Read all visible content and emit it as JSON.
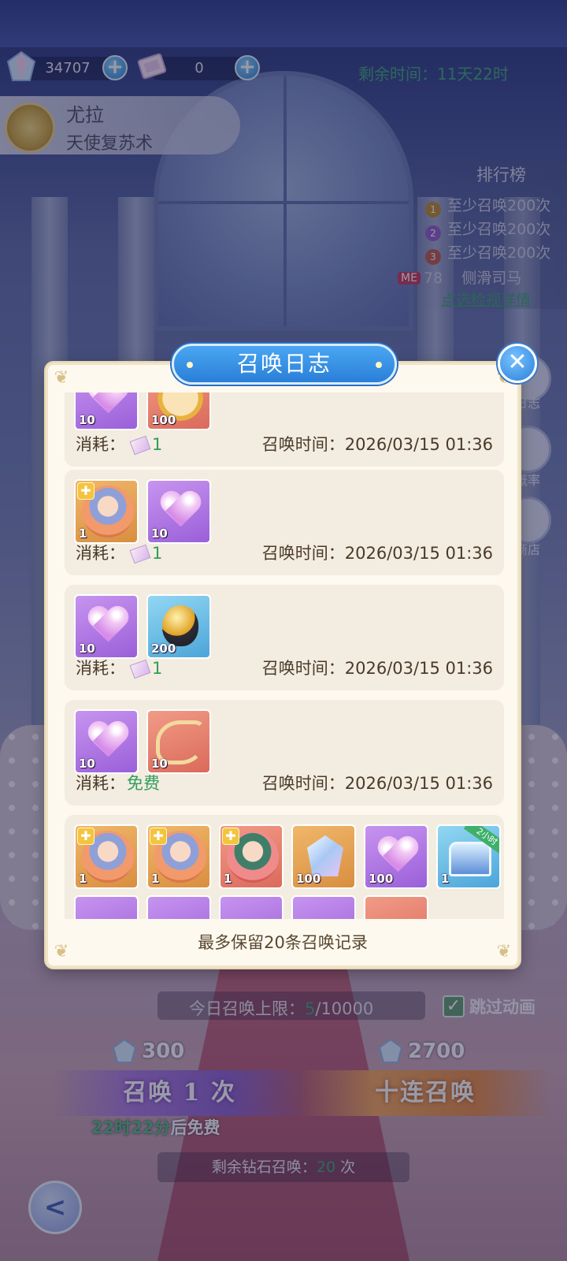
{
  "currency": {
    "diamond_amount": "34707",
    "ticket_amount": "0",
    "plus_symbol": "+",
    "remaining_label": "剩余时间：11天22时"
  },
  "character": {
    "name": "尤拉",
    "subtitle": "天使复苏术"
  },
  "ranking": {
    "title": "排行榜",
    "rows": [
      {
        "medal": "1",
        "text": "至少召唤200次",
        "color": "#b9892f"
      },
      {
        "medal": "2",
        "text": "至少召唤200次",
        "color": "#8e59c9"
      },
      {
        "medal": "3",
        "text": "至少召唤200次",
        "color": "#b8584a"
      }
    ],
    "me_badge": "ME",
    "me_rank": "78",
    "me_name": "侧滑司马",
    "detail_link": "点选检视详情"
  },
  "side_buttons": {
    "log_label": "日志",
    "rate_label": "概率",
    "shop_label": "商店"
  },
  "modal": {
    "title": "召唤日志",
    "close_symbol": "✕",
    "note": "最多保留20条召唤记录",
    "records": [
      {
        "cost_label": "消耗：",
        "cost_value": "1",
        "time_label": "召唤时间：",
        "time": "2026/03/15 01:36",
        "items": [
          {
            "type": "heart",
            "color": "purple",
            "qty": "10"
          },
          {
            "type": "coin",
            "color": "red",
            "qty": "100"
          }
        ]
      },
      {
        "cost_label": "消耗：",
        "cost_value": "1",
        "time_label": "召唤时间：",
        "time": "2026/03/15 01:36",
        "items": [
          {
            "type": "fragment",
            "color": "gold",
            "qty": "1",
            "puzzle": true
          },
          {
            "type": "heart",
            "color": "purple",
            "qty": "10"
          }
        ]
      },
      {
        "cost_label": "消耗：",
        "cost_value": "1",
        "time_label": "召唤时间：",
        "time": "2026/03/15 01:36",
        "items": [
          {
            "type": "heart",
            "color": "purple",
            "qty": "10"
          },
          {
            "type": "egg",
            "color": "blue",
            "qty": "200"
          }
        ]
      },
      {
        "cost_label": "消耗：",
        "cost_value": "免费",
        "time_label": "召唤时间：",
        "time": "2026/03/15 01:36",
        "items": [
          {
            "type": "heart",
            "color": "purple",
            "qty": "10"
          },
          {
            "type": "dragon",
            "color": "red",
            "qty": "10"
          }
        ]
      },
      {
        "items": [
          {
            "type": "fragment",
            "color": "gold",
            "qty": "1",
            "puzzle": true
          },
          {
            "type": "fragment",
            "color": "gold",
            "qty": "1",
            "puzzle": true
          },
          {
            "type": "fragment",
            "color": "red",
            "qty": "1",
            "puzzle": true
          },
          {
            "type": "crystal",
            "color": "gold",
            "qty": "100"
          },
          {
            "type": "heart",
            "color": "purple",
            "qty": "100"
          },
          {
            "type": "chest",
            "color": "blue",
            "qty": "1",
            "tag": "2小时"
          }
        ]
      }
    ]
  },
  "bottom": {
    "limit_label": "今日召唤上限：",
    "limit_value": "5",
    "limit_max": "/10000",
    "skip_label": "跳过动画",
    "skip_checked": "✓",
    "cost_one": "300",
    "cost_ten": "2700",
    "summon_one": "召唤 1 次",
    "summon_ten": "十连召唤",
    "free_time": "22时22分",
    "free_suffix": "后免费",
    "remain_label": "剩余钻石召唤：",
    "remain_value": "20",
    "remain_unit": " 次",
    "back_symbol": "<"
  }
}
